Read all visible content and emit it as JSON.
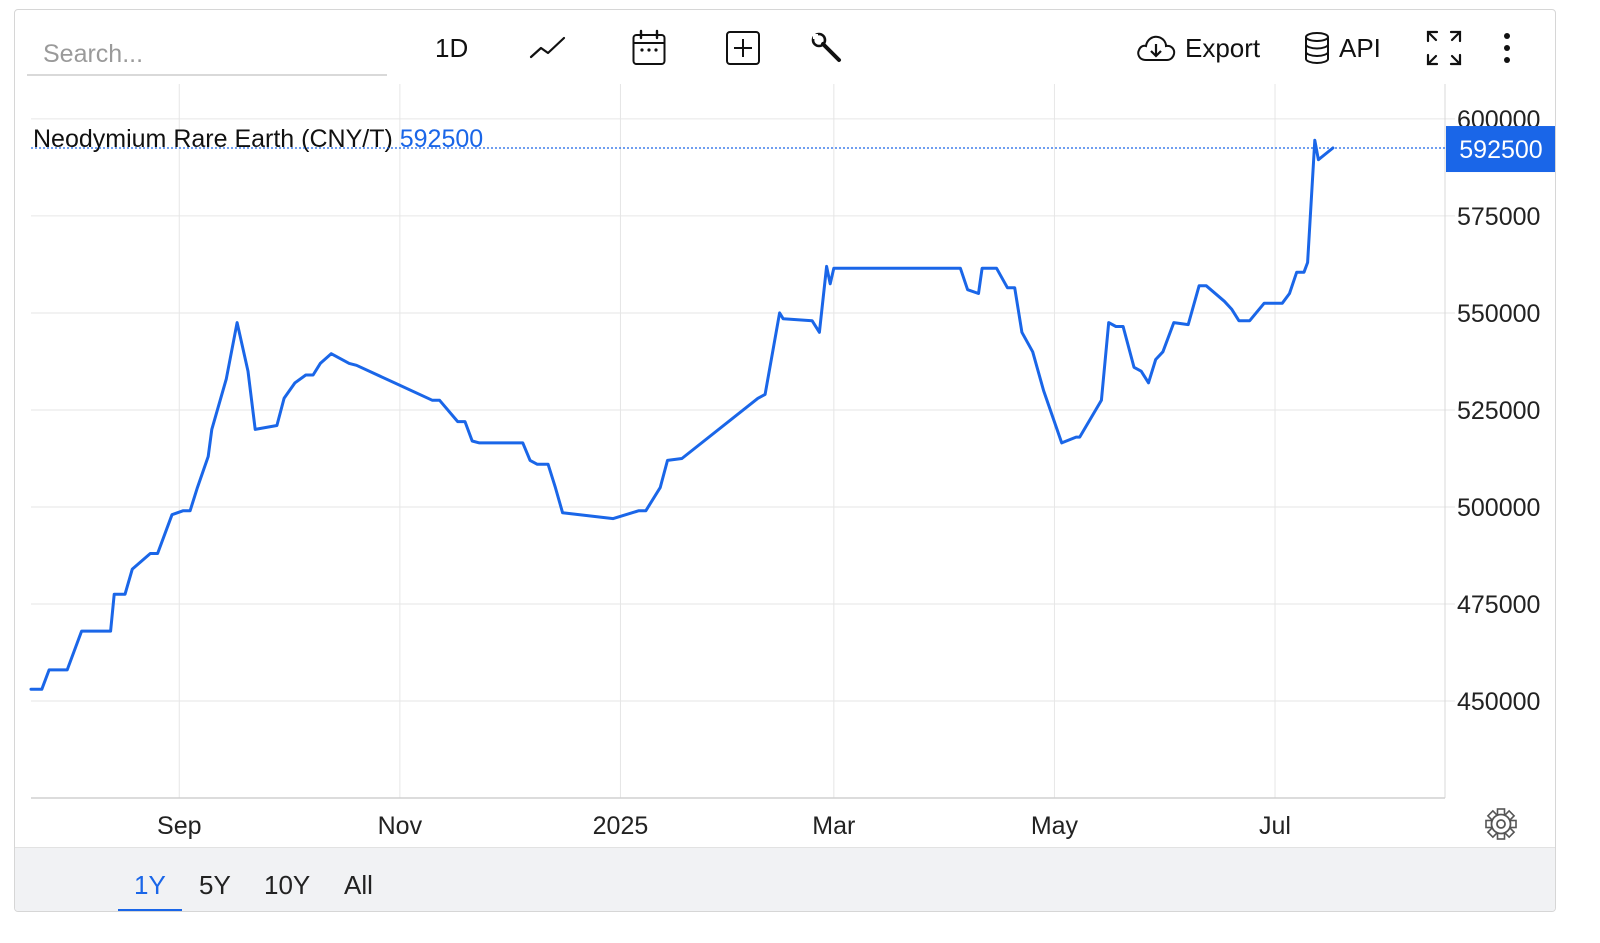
{
  "toolbar": {
    "search_placeholder": "Search...",
    "interval_label": "1D",
    "export_label": "Export",
    "api_label": "API"
  },
  "ranges": [
    {
      "label": "1Y",
      "active": true
    },
    {
      "label": "5Y",
      "active": false
    },
    {
      "label": "10Y",
      "active": false
    },
    {
      "label": "All",
      "active": false
    }
  ],
  "colors": {
    "series": "#1a66e8",
    "grid": "#e6e6e6",
    "badge": "#1a66e8"
  },
  "chart_data": {
    "type": "line",
    "title": "Neodymium Rare Earth (CNY/T)",
    "last_value_label": "592500",
    "last_value": 592500,
    "y_ticks": [
      450000,
      475000,
      500000,
      525000,
      550000,
      575000,
      600000
    ],
    "y_tick_labels": [
      "450000",
      "475000",
      "500000",
      "525000",
      "550000",
      "575000",
      "600000"
    ],
    "ylim": [
      425000,
      609000
    ],
    "x_ticks": [
      {
        "label": "Sep",
        "date": "2024-09-01"
      },
      {
        "label": "Nov",
        "date": "2024-11-01"
      },
      {
        "label": "2025",
        "date": "2025-01-01"
      },
      {
        "label": "Mar",
        "date": "2025-03-01"
      },
      {
        "label": "May",
        "date": "2025-05-01"
      },
      {
        "label": "Jul",
        "date": "2025-07-01"
      }
    ],
    "xlim": [
      "2024-07-22",
      "2025-08-17"
    ],
    "grid": true,
    "series": [
      {
        "x": [
          "2024-07-22",
          "2024-07-25",
          "2024-07-27",
          "2024-08-01",
          "2024-08-05",
          "2024-08-13",
          "2024-08-14",
          "2024-08-17",
          "2024-08-19",
          "2024-08-24",
          "2024-08-26",
          "2024-08-30",
          "2024-09-02",
          "2024-09-04",
          "2024-09-06",
          "2024-09-09",
          "2024-09-10",
          "2024-09-14",
          "2024-09-17",
          "2024-09-20",
          "2024-09-22",
          "2024-09-28",
          "2024-09-30",
          "2024-10-03",
          "2024-10-06",
          "2024-10-08",
          "2024-10-10",
          "2024-10-13",
          "2024-10-18",
          "2024-10-20",
          "2024-11-10",
          "2024-11-12",
          "2024-11-17",
          "2024-11-19",
          "2024-11-21",
          "2024-11-23",
          "2024-11-25",
          "2024-12-05",
          "2024-12-07",
          "2024-12-09",
          "2024-12-12",
          "2024-12-14",
          "2024-12-16",
          "2024-12-30",
          "2025-01-06",
          "2025-01-08",
          "2025-01-12",
          "2025-01-14",
          "2025-01-18",
          "2025-02-08",
          "2025-02-10",
          "2025-02-14",
          "2025-02-15",
          "2025-02-23",
          "2025-02-25",
          "2025-02-27",
          "2025-02-28",
          "2025-03-01",
          "2025-03-03",
          "2025-04-05",
          "2025-04-07",
          "2025-04-10",
          "2025-04-11",
          "2025-04-15",
          "2025-04-18",
          "2025-04-20",
          "2025-04-22",
          "2025-04-25",
          "2025-04-28",
          "2025-05-03",
          "2025-05-07",
          "2025-05-08",
          "2025-05-14",
          "2025-05-16",
          "2025-05-18",
          "2025-05-20",
          "2025-05-23",
          "2025-05-25",
          "2025-05-27",
          "2025-05-29",
          "2025-05-31",
          "2025-06-03",
          "2025-06-07",
          "2025-06-10",
          "2025-06-12",
          "2025-06-17",
          "2025-06-19",
          "2025-06-21",
          "2025-06-24",
          "2025-06-28",
          "2025-06-30",
          "2025-07-03",
          "2025-07-05",
          "2025-07-07",
          "2025-07-09",
          "2025-07-10",
          "2025-07-12",
          "2025-07-13",
          "2025-07-17"
        ],
        "y": [
          453000,
          453000,
          458000,
          458000,
          468000,
          468000,
          477500,
          477500,
          484000,
          488000,
          488000,
          498000,
          499000,
          499000,
          505000,
          513000,
          520000,
          533000,
          547500,
          535000,
          520000,
          521000,
          528000,
          532000,
          534000,
          534000,
          537000,
          539500,
          537000,
          536500,
          527500,
          527500,
          522000,
          522000,
          517000,
          516500,
          516500,
          516500,
          512000,
          511000,
          511000,
          505000,
          498500,
          497000,
          499000,
          499000,
          505000,
          512000,
          512500,
          528000,
          529000,
          550000,
          548500,
          548000,
          545000,
          562000,
          557500,
          561500,
          561500,
          561500,
          556000,
          555000,
          561500,
          561500,
          556500,
          556500,
          545000,
          540000,
          530000,
          516500,
          518000,
          518000,
          527500,
          547500,
          546500,
          546500,
          536000,
          535000,
          532000,
          538000,
          540000,
          547500,
          547000,
          557000,
          557000,
          553000,
          551000,
          548000,
          548000,
          552500,
          552500,
          552500,
          555000,
          560500,
          560500,
          563000,
          594500,
          589500,
          592500
        ]
      }
    ]
  }
}
